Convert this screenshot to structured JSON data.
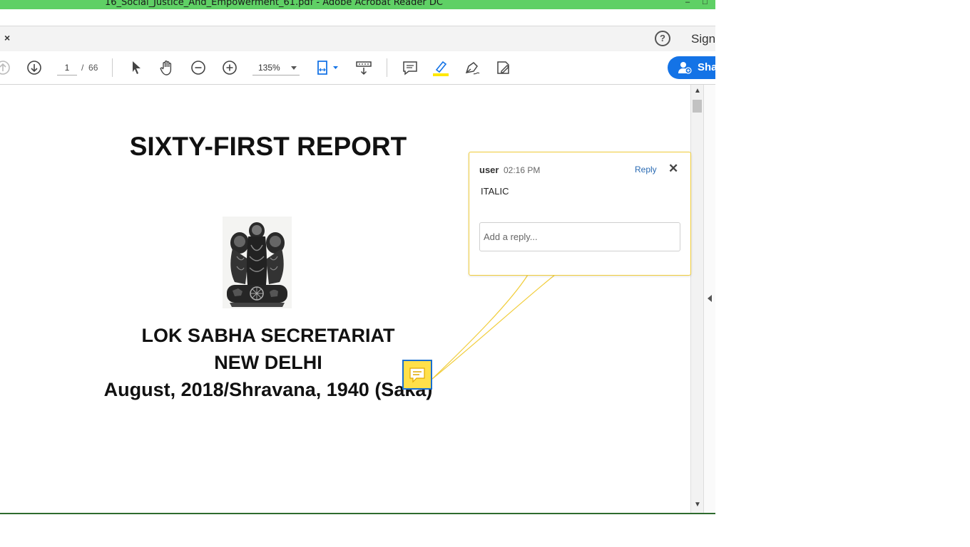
{
  "window": {
    "title": "16_Social_Justice_And_Empowerment_61.pdf - Adobe Acrobat Reader DC",
    "minimize": "–",
    "maximize": "□"
  },
  "menubar": {
    "close_tab": "×",
    "help": "?",
    "sign": "Sign"
  },
  "toolbar": {
    "page_current": "1",
    "page_separator": "/",
    "page_total": "66",
    "zoom": "135%",
    "share": "Sha"
  },
  "document": {
    "title": "SIXTY-FIRST REPORT",
    "line1": "LOK SABHA SECRETARIAT",
    "line2": "NEW DELHI",
    "line3": "August, 2018/Shravana, 1940 (Saka)"
  },
  "comment": {
    "author": "user",
    "time": "02:16 PM",
    "reply_label": "Reply",
    "close": "✕",
    "text": "ITALIC",
    "reply_placeholder": "Add a reply..."
  },
  "colors": {
    "titlebar": "#5fd065",
    "accent": "#1473e6",
    "comment_border": "#f1cd3a",
    "note_fill": "#ffe04a",
    "highlighter": "#ffe800"
  }
}
